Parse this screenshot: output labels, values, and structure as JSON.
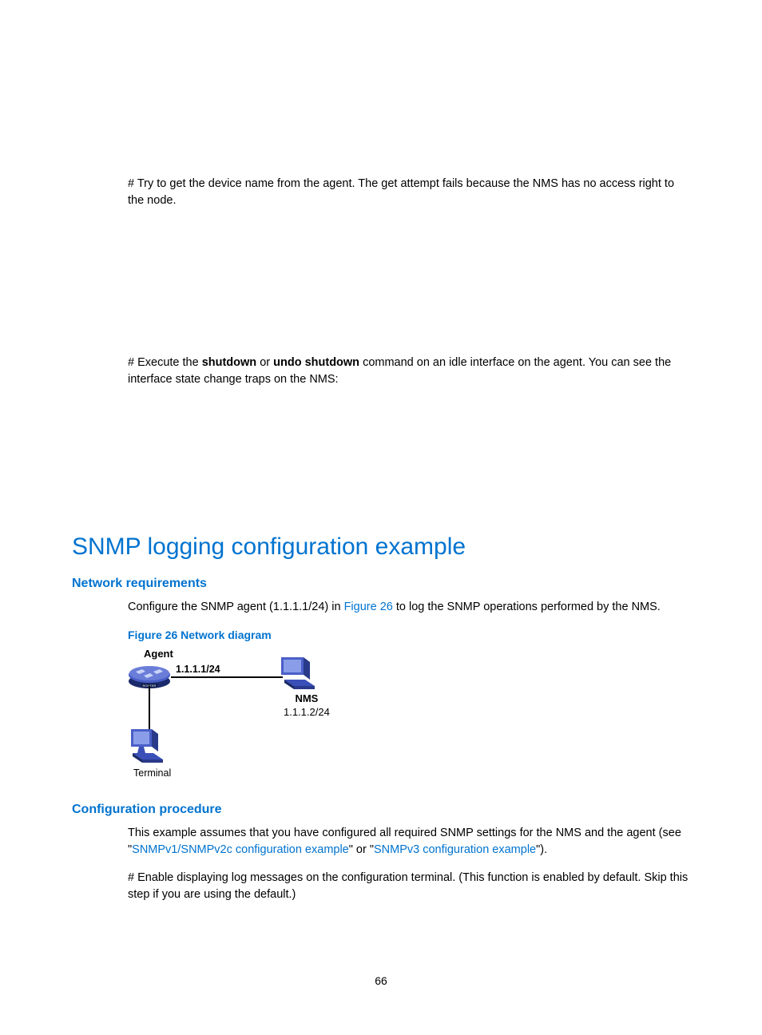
{
  "para1": "# Try to get the device name from the agent. The get attempt fails because the NMS has no access right to the node.",
  "para2_prefix": "# Execute the ",
  "para2_bold1": "shutdown",
  "para2_mid": " or ",
  "para2_bold2": "undo shutdown",
  "para2_suffix": " command on an idle interface on the agent. You can see the interface state change traps on the NMS:",
  "h1": "SNMP logging configuration example",
  "h2a": "Network requirements",
  "nr_prefix": "Configure the SNMP agent (1.1.1.1/24) in ",
  "nr_link": "Figure 26",
  "nr_suffix": " to log the SNMP operations performed by the NMS.",
  "fig_caption": "Figure 26 Network diagram",
  "diagram": {
    "agent_label": "Agent",
    "ip_agent": "1.1.1.1/24",
    "nms_label": "NMS",
    "ip_nms": "1.1.1.2/24",
    "terminal_label": "Terminal"
  },
  "h2b": "Configuration procedure",
  "cp_prefix": "This example assumes that you have configured all required SNMP settings for the NMS and the agent (see \"",
  "cp_link1": "SNMPv1/SNMPv2c configuration example",
  "cp_mid": "\" or \"",
  "cp_link2": "SNMPv3 configuration example",
  "cp_suffix": "\").",
  "cp_para2": "# Enable displaying log messages on the configuration terminal. (This function is enabled by default. Skip this step if you are using the default.)",
  "page_number": "66"
}
